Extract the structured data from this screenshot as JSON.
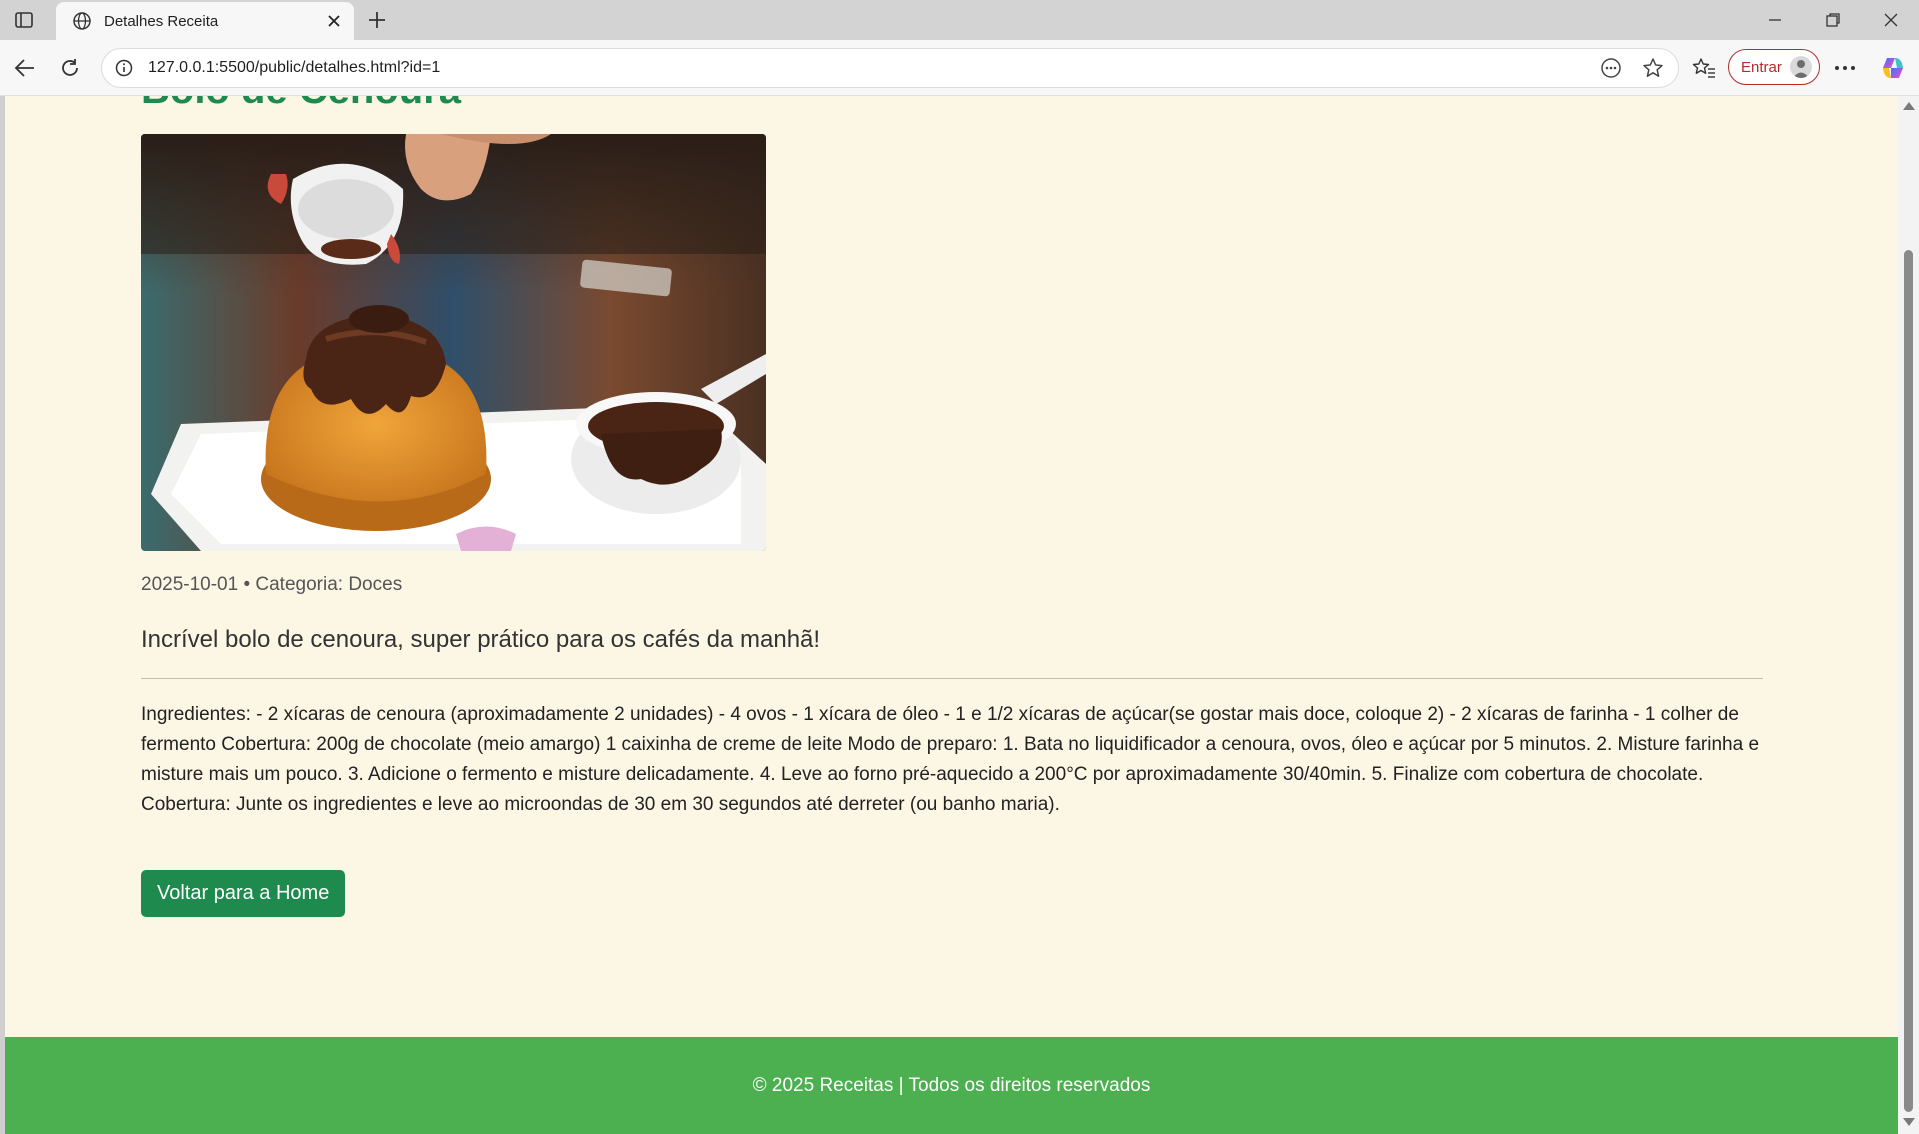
{
  "browser": {
    "tab_title": "Detalhes Receita",
    "url": "127.0.0.1:5500/public/detalhes.html?id=1",
    "signin_label": "Entrar"
  },
  "recipe": {
    "title": "Bolo de Cenoura",
    "meta": "2025-10-01 • Categoria: Doces",
    "lead": "Incrível bolo de cenoura, super prático para os cafés da manhã!",
    "body": "Ingredientes: - 2 xícaras de cenoura (aproximadamente 2 unidades) - 4 ovos - 1 xícara de óleo - 1 e 1/2 xícaras de açúcar(se gostar mais doce, coloque 2) - 2 xícaras de farinha - 1 colher de fermento Cobertura: 200g de chocolate (meio amargo) 1 caixinha de creme de leite Modo de preparo: 1. Bata no liquidificador a cenoura, ovos, óleo e açúcar por 5 minutos. 2. Misture farinha e misture mais um pouco. 3. Adicione o fermento e misture delicadamente. 4. Leve ao forno pré-aquecido a 200°C por aproximadamente 30/40min. 5. Finalize com cobertura de chocolate. Cobertura: Junte os ingredientes e leve ao microondas de 30 em 30 segundos até derreter (ou banho maria).",
    "back_button": "Voltar para a Home"
  },
  "footer": {
    "text": "© 2025 Receitas | Todos os direitos reservados"
  },
  "icons": [
    "tab-actions-icon",
    "globe-icon",
    "close-icon",
    "plus-icon",
    "minimize-icon",
    "restore-icon",
    "close-window-icon",
    "back-icon",
    "refresh-icon",
    "info-icon",
    "reader-icon",
    "star-icon",
    "favorites-icon",
    "avatar-icon",
    "more-icon",
    "copilot-icon"
  ],
  "colors": {
    "page_bg": "#fcf6e5",
    "title_green": "#1e8a4e",
    "button_green": "#1e8a4e",
    "footer_green": "#4caf50"
  }
}
